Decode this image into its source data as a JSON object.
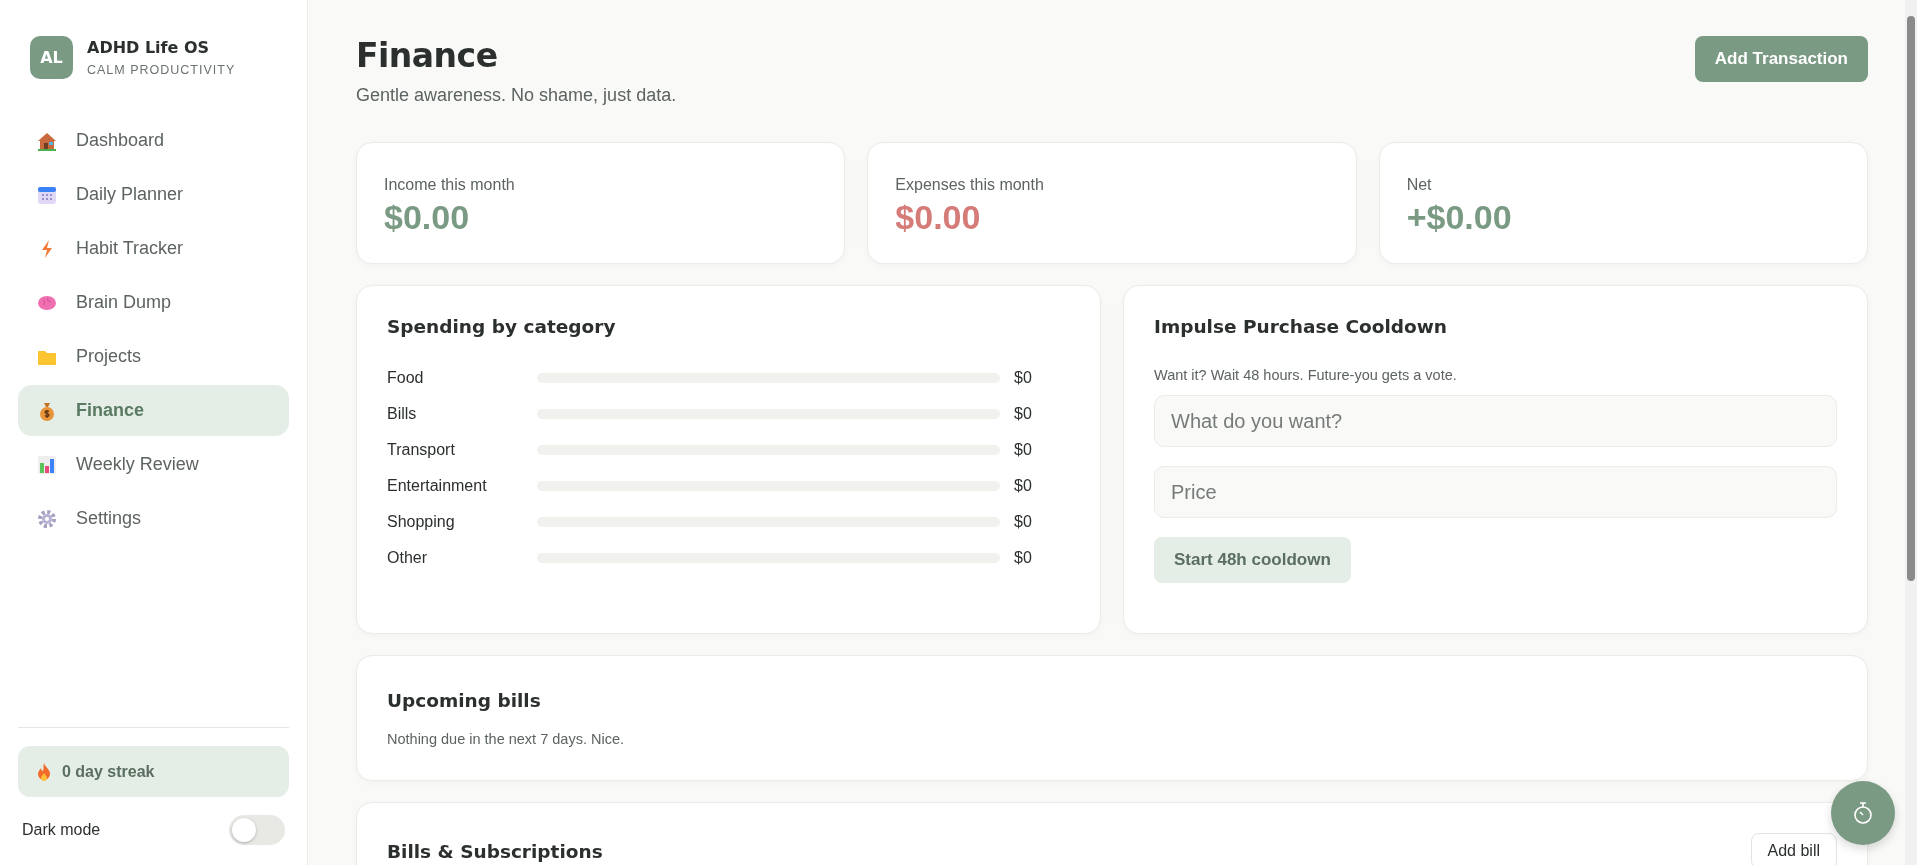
{
  "brand": {
    "initials": "AL",
    "name": "ADHD Life OS",
    "tagline": "CALM PRODUCTIVITY"
  },
  "nav": [
    {
      "label": "Dashboard",
      "selected": false
    },
    {
      "label": "Daily Planner",
      "selected": false
    },
    {
      "label": "Habit Tracker",
      "selected": false
    },
    {
      "label": "Brain Dump",
      "selected": false
    },
    {
      "label": "Projects",
      "selected": false
    },
    {
      "label": "Finance",
      "selected": true
    },
    {
      "label": "Weekly Review",
      "selected": false
    },
    {
      "label": "Settings",
      "selected": false
    }
  ],
  "streak": "0 day streak",
  "dark_mode": {
    "label": "Dark mode",
    "on": false
  },
  "header": {
    "title": "Finance",
    "subtitle": "Gentle awareness. No shame, just data.",
    "action": "Add Transaction"
  },
  "stats": [
    {
      "label": "Income this month",
      "value": "$0.00",
      "color": "#7a9a84"
    },
    {
      "label": "Expenses this month",
      "value": "$0.00",
      "color": "#d57b78"
    },
    {
      "label": "Net",
      "value": "+$0.00",
      "color": "#7a9a84"
    }
  ],
  "spending": {
    "title": "Spending by category",
    "rows": [
      {
        "name": "Food",
        "level": 0,
        "amount": "$0"
      },
      {
        "name": "Bills",
        "level": 0,
        "amount": "$0"
      },
      {
        "name": "Transport",
        "level": 0,
        "amount": "$0"
      },
      {
        "name": "Entertainment",
        "level": 0,
        "amount": "$0"
      },
      {
        "name": "Shopping",
        "level": 0,
        "amount": "$0"
      },
      {
        "name": "Other",
        "level": 0,
        "amount": "$0"
      }
    ]
  },
  "cooldown": {
    "title": "Impulse Purchase Cooldown",
    "hint": "Want it? Wait 48 hours. Future-you gets a vote.",
    "fields": [
      {
        "placeholder": "What do you want?"
      },
      {
        "placeholder": "Price"
      }
    ],
    "button": "Start 48h cooldown"
  },
  "upcoming": {
    "title": "Upcoming bills",
    "empty": "Nothing due in the next 7 days. Nice."
  },
  "bills": {
    "title": "Bills & Subscriptions",
    "button": "Add bill"
  }
}
